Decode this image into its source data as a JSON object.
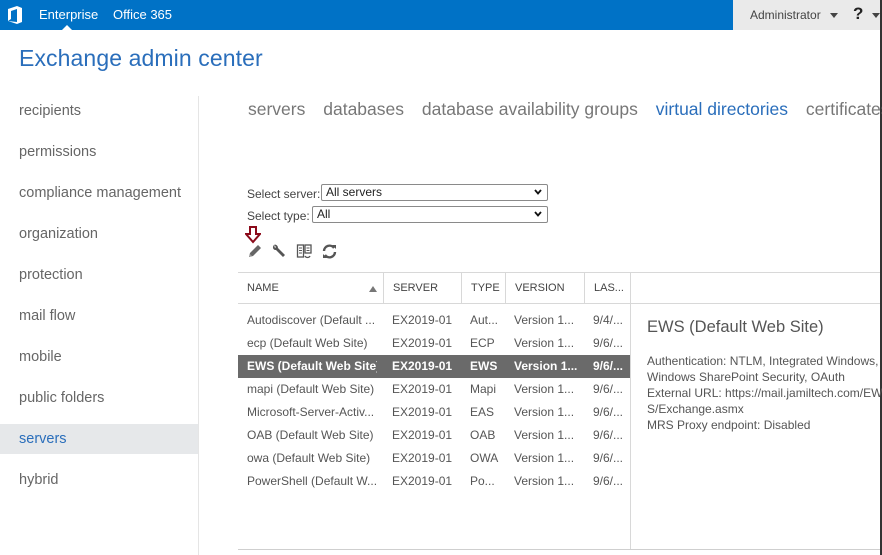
{
  "topbar": {
    "logo": "office-logo",
    "nav": [
      "Enterprise",
      "Office 365"
    ],
    "active_nav": "Enterprise",
    "user": "Administrator",
    "help": "?",
    "brand_color": "#0072c6"
  },
  "header": {
    "title": "Exchange admin center"
  },
  "sidebar": {
    "active": "servers",
    "items": [
      {
        "label": "recipients"
      },
      {
        "label": "permissions"
      },
      {
        "label": "compliance management"
      },
      {
        "label": "organization"
      },
      {
        "label": "protection"
      },
      {
        "label": "mail flow"
      },
      {
        "label": "mobile"
      },
      {
        "label": "public folders"
      },
      {
        "label": "servers"
      },
      {
        "label": "hybrid"
      }
    ]
  },
  "tabs": {
    "active": "virtual directories",
    "items": [
      {
        "label": "servers"
      },
      {
        "label": "databases"
      },
      {
        "label": "database availability groups"
      },
      {
        "label": "virtual directories"
      },
      {
        "label": "certificates"
      }
    ]
  },
  "filters": {
    "server_label": "Select server:",
    "server_value": "All servers",
    "type_label": "Select type:",
    "type_value": "All"
  },
  "toolbar": {
    "icons": [
      "edit-pencil-icon",
      "configure-wrench-icon",
      "reset-virtual-directory-icon",
      "refresh-icon"
    ]
  },
  "grid": {
    "columns": [
      {
        "label": "NAME",
        "sorted": "ascending"
      },
      {
        "label": "SERVER"
      },
      {
        "label": "TYPE"
      },
      {
        "label": "VERSION"
      },
      {
        "label": "LAS..."
      }
    ],
    "selected_index": 2,
    "rows": [
      {
        "name": "Autodiscover (Default ...",
        "server": "EX2019-01",
        "type": "Aut...",
        "version": "Version 1...",
        "last": "9/4/..."
      },
      {
        "name": "ecp (Default Web Site)",
        "server": "EX2019-01",
        "type": "ECP",
        "version": "Version 1...",
        "last": "9/6/..."
      },
      {
        "name": "EWS (Default Web Site)",
        "server": "EX2019-01",
        "type": "EWS",
        "version": "Version 1...",
        "last": "9/6/..."
      },
      {
        "name": "mapi (Default Web Site)",
        "server": "EX2019-01",
        "type": "Mapi",
        "version": "Version 1...",
        "last": "9/6/..."
      },
      {
        "name": "Microsoft-Server-Activ...",
        "server": "EX2019-01",
        "type": "EAS",
        "version": "Version 1...",
        "last": "9/6/..."
      },
      {
        "name": "OAB (Default Web Site)",
        "server": "EX2019-01",
        "type": "OAB",
        "version": "Version 1...",
        "last": "9/6/..."
      },
      {
        "name": "owa (Default Web Site)",
        "server": "EX2019-01",
        "type": "OWA",
        "version": "Version 1...",
        "last": "9/6/..."
      },
      {
        "name": "PowerShell (Default W...",
        "server": "EX2019-01",
        "type": "Po...",
        "version": "Version 1...",
        "last": "9/6/..."
      }
    ]
  },
  "details": {
    "title": "EWS (Default Web Site)",
    "lines": [
      "Authentication: NTLM, Integrated Windows,",
      "Windows SharePoint Security, OAuth",
      "External URL: https://mail.jamiltech.com/EW",
      "S/Exchange.asmx",
      "MRS Proxy endpoint: Disabled"
    ]
  }
}
